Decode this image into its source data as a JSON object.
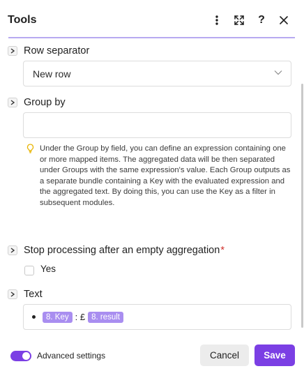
{
  "header": {
    "title": "Tools",
    "icons": [
      "more-vertical-icon",
      "expand-icon",
      "help-icon",
      "close-icon"
    ],
    "help_glyph": "?"
  },
  "sections": {
    "row_separator": {
      "label": "Row separator",
      "value": "New row"
    },
    "group_by": {
      "label": "Group by",
      "value": "",
      "hint": "Under the Group by field, you can define an expression containing one or more mapped items. The aggregated data will be then separated under Groups with the same expression's value. Each Group outputs as a separate bundle containing a Key with the evaluated expression and the aggregated text. By doing this, you can use the Key as a filter in subsequent modules."
    },
    "stop_processing": {
      "label": "Stop processing after an empty aggregation",
      "required_mark": "*",
      "option_label": "Yes",
      "checked": false
    },
    "text": {
      "label": "Text",
      "pill_key": "8. Key",
      "separator": ": £",
      "pill_result": "8. result"
    }
  },
  "footer": {
    "advanced_label": "Advanced settings",
    "advanced_enabled": true,
    "cancel_label": "Cancel",
    "save_label": "Save"
  },
  "colors": {
    "accent": "#7b3fe4",
    "pill": "#a98ef0",
    "header_line": "#b7a9f0",
    "hint_icon": "#e8b400",
    "required": "#d0312d"
  }
}
